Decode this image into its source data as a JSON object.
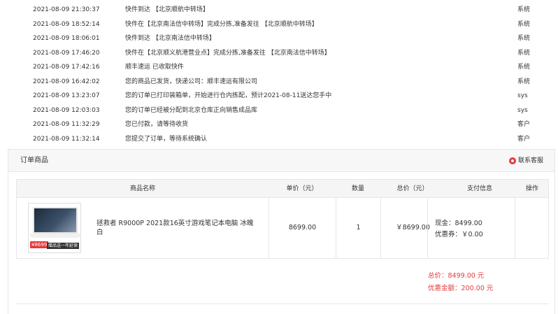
{
  "logs": [
    {
      "time": "2021-08-09 21:30:37",
      "msg": "快件到达 【北京顺航中转场】",
      "op": "系统"
    },
    {
      "time": "2021-08-09 18:52:14",
      "msg": "快件在【北京南法信中转场】完成分拣,准备发往 【北京顺航中转场】",
      "op": "系统"
    },
    {
      "time": "2021-08-09 18:06:01",
      "msg": "快件到达 【北京南法信中转场】",
      "op": "系统"
    },
    {
      "time": "2021-08-09 17:46:20",
      "msg": "快件在【北京顺义航港营业点】完成分拣,准备发往 【北京南法信中转场】",
      "op": "系统"
    },
    {
      "time": "2021-08-09 17:42:16",
      "msg": "顺丰速运 已收取快件",
      "op": "系统"
    },
    {
      "time": "2021-08-09 16:42:02",
      "msg": "您的商品已发货，快递公司：顺丰速运有限公司",
      "op": "系统"
    },
    {
      "time": "2021-08-09 13:23:07",
      "msg": "您的订单已打印装箱单，开始进行仓内拣配，预计2021-08-11送达您手中",
      "op": "sys"
    },
    {
      "time": "2021-08-09 12:03:03",
      "msg": "您的订单已经被分配到北京仓库正向销售成品库",
      "op": "sys"
    },
    {
      "time": "2021-08-09 11:32:29",
      "msg": "您已付款，请等待收货",
      "op": "客户"
    },
    {
      "time": "2021-08-09 11:32:14",
      "msg": "您提交了订单，等待系统确认",
      "op": "客户"
    }
  ],
  "section": {
    "title": "订单商品",
    "service_label": "联系客服",
    "service_icon": "chat-bubble-icon"
  },
  "table": {
    "headers": {
      "name": "商品名称",
      "price": "单价（元）",
      "qty": "数量",
      "total": "总价（元）",
      "pay": "支付信息",
      "ops": "操作"
    },
    "row": {
      "thumb_price": "¥8699",
      "thumb_badge": "赠品送一年延保",
      "name": "拯救者 R9000P 2021款16英寸游戏笔记本电脑 冰魄白",
      "price": "8699.00",
      "qty": "1",
      "total": "￥8699.00",
      "cash": "现金：8499.00",
      "coupon": "优惠券：￥0.00"
    }
  },
  "summary": {
    "total": "总价：8499.00 元",
    "discount": "优惠金额：200.00 元"
  },
  "colors": {
    "accent": "#e4393c"
  }
}
